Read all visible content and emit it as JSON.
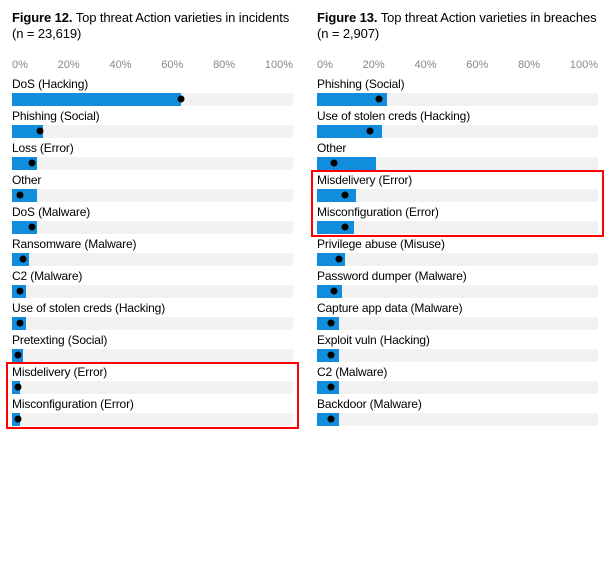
{
  "axis_ticks": [
    "0%",
    "20%",
    "40%",
    "60%",
    "80%",
    "100%"
  ],
  "left": {
    "fig_label": "Figure 12.",
    "fig_rest": " Top threat Action varieties in incidents (n = 23,619)"
  },
  "right": {
    "fig_label": "Figure 13.",
    "fig_rest": " Top threat Action varieties in breaches (n = 2,907)"
  },
  "chart_data": [
    {
      "type": "bar",
      "title": "Figure 12. Top threat Action varieties in incidents (n = 23,619)",
      "xlabel": "",
      "ylabel": "",
      "ylim": [
        0,
        100
      ],
      "categories": [
        "DoS (Hacking)",
        "Phishing (Social)",
        "Loss (Error)",
        "Other",
        "DoS (Malware)",
        "Ransomware (Malware)",
        "C2 (Malware)",
        "Use of stolen creds (Hacking)",
        "Pretexting (Social)",
        "Misdelivery (Error)",
        "Misconfiguration (Error)"
      ],
      "values": [
        60,
        11,
        9,
        9,
        9,
        6,
        5,
        5,
        4,
        3,
        3
      ],
      "dots": [
        60,
        10,
        7,
        3,
        7,
        4,
        3,
        3,
        2,
        2,
        2
      ],
      "highlight_rows": [
        9,
        10
      ]
    },
    {
      "type": "bar",
      "title": "Figure 13. Top threat Action varieties in breaches (n = 2,907)",
      "xlabel": "",
      "ylabel": "",
      "ylim": [
        0,
        100
      ],
      "categories": [
        "Phishing (Social)",
        "Use of stolen creds (Hacking)",
        "Other",
        "Misdelivery (Error)",
        "Misconfiguration (Error)",
        "Privilege abuse (Misuse)",
        "Password dumper (Malware)",
        "Capture app data (Malware)",
        "Exploit vuln (Hacking)",
        "C2 (Malware)",
        "Backdoor (Malware)"
      ],
      "values": [
        25,
        23,
        21,
        14,
        13,
        10,
        9,
        8,
        8,
        8,
        8
      ],
      "dots": [
        22,
        19,
        6,
        10,
        10,
        8,
        6,
        5,
        5,
        5,
        5
      ],
      "highlight_rows": [
        3,
        4
      ]
    }
  ]
}
